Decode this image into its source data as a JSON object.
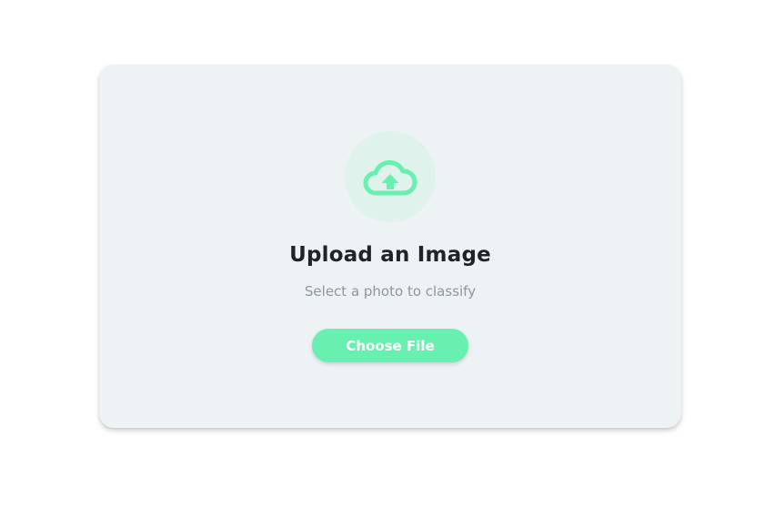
{
  "upload_card": {
    "title": "Upload an Image",
    "subtitle": "Select a photo to classify",
    "button_label": "Choose File",
    "icon": "cloud-upload-icon"
  },
  "colors": {
    "accent": "#68f0b0",
    "icon_circle": "#dff2ec",
    "card_background": "#edf2f4",
    "title_text": "#1f2428",
    "subtitle_text": "#8f979d"
  }
}
